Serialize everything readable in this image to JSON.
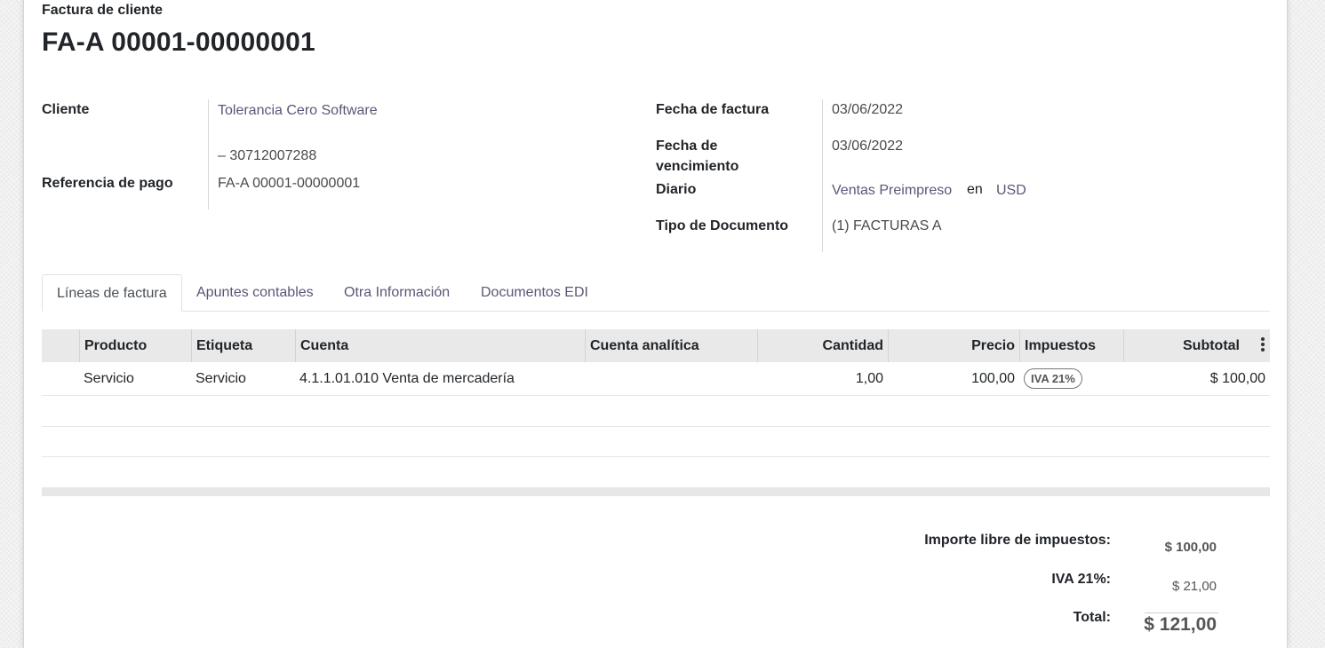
{
  "header": {
    "doc_type": "Factura de cliente",
    "doc_number": "FA-A 00001-00000001"
  },
  "left_fields": {
    "cliente_label": "Cliente",
    "cliente_value": "Tolerancia Cero Software",
    "cliente_vat": "– 30712007288",
    "referencia_label": "Referencia de pago",
    "referencia_value": "FA-A 00001-00000001"
  },
  "right_fields": {
    "fecha_factura_label": "Fecha de factura",
    "fecha_factura_value": "03/06/2022",
    "fecha_venc_label_1": "Fecha de",
    "fecha_venc_label_2": "vencimiento",
    "fecha_venc_value": "03/06/2022",
    "diario_label": "Diario",
    "diario_value": "Ventas Preimpreso",
    "diario_en": "en",
    "diario_currency": "USD",
    "tipo_doc_label": "Tipo de Documento",
    "tipo_doc_value": "(1) FACTURAS A"
  },
  "tabs": [
    {
      "label": "Líneas de factura",
      "active": true
    },
    {
      "label": "Apuntes contables",
      "active": false
    },
    {
      "label": "Otra Información",
      "active": false
    },
    {
      "label": "Documentos EDI",
      "active": false
    }
  ],
  "table": {
    "columns": [
      "Producto",
      "Etiqueta",
      "Cuenta",
      "Cuenta analítica",
      "Cantidad",
      "Precio",
      "Impuestos",
      "Subtotal"
    ],
    "rows": [
      {
        "producto": "Servicio",
        "etiqueta": "Servicio",
        "cuenta": "4.1.1.01.010 Venta de mercadería",
        "cuenta_analitica": "",
        "cantidad": "1,00",
        "precio": "100,00",
        "impuesto": "IVA 21%",
        "subtotal": "$ 100,00"
      }
    ]
  },
  "totals": {
    "untaxed_label": "Importe libre de impuestos:",
    "untaxed_value": "$ 100,00",
    "tax_label": "IVA 21%:",
    "tax_value": "$ 21,00",
    "total_label": "Total:",
    "total_value": "$ 121,00"
  },
  "colors": {
    "link": "#5d5577",
    "table_header_bg": "#e9e9e9"
  }
}
